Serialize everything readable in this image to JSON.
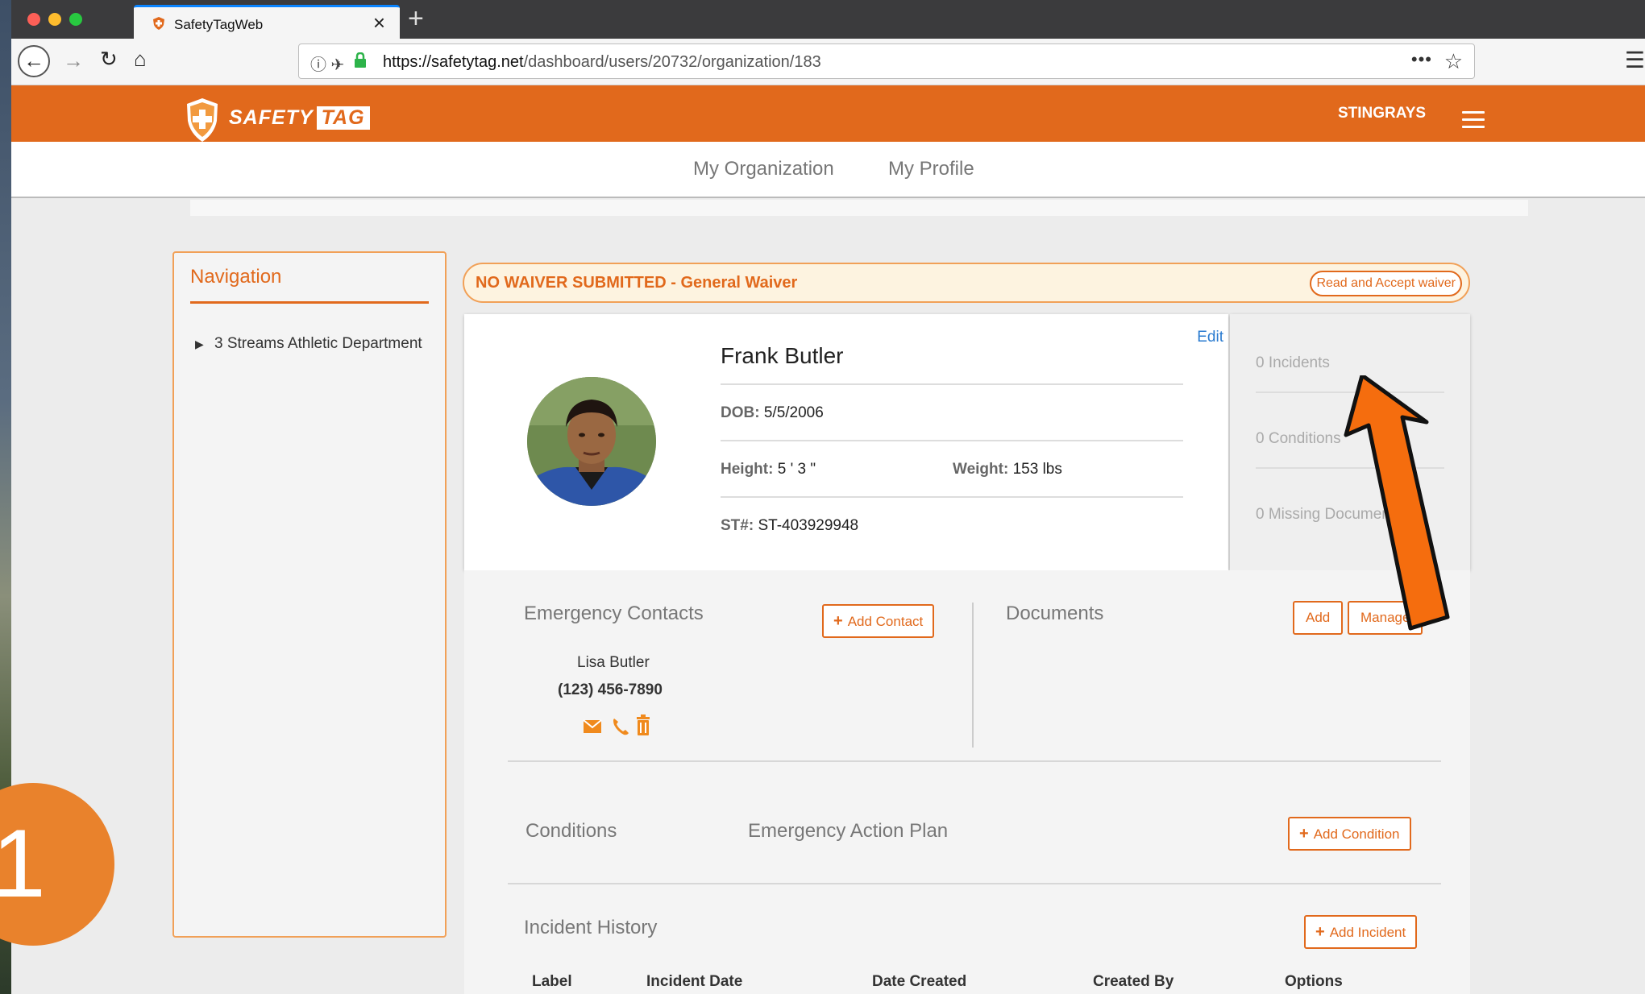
{
  "browser": {
    "tab_title": "SafetyTagWeb",
    "url_host": "https://safetytag.net",
    "url_path": "/dashboard/users/20732/organization/183"
  },
  "header": {
    "logo_text": "SAFETY",
    "logo_tag": "TAG",
    "org_name": "STINGRAYS",
    "brand_color": "#e1691c"
  },
  "subnav": {
    "my_organization": "My Organization",
    "my_profile": "My Profile"
  },
  "navigation": {
    "title": "Navigation",
    "items": [
      {
        "label": "3 Streams Athletic Department"
      }
    ]
  },
  "waiver": {
    "status": "NO WAIVER SUBMITTED - General Waiver",
    "button": "Read and Accept waiver"
  },
  "profile": {
    "name": "Frank Butler",
    "edit": "Edit",
    "dob_label": "DOB:",
    "dob": "5/5/2006",
    "height_label": "Height:",
    "height": "5 ' 3 \"",
    "weight_label": "Weight:",
    "weight": "153 lbs",
    "st_label": "ST#:",
    "st_number": "ST-403929948"
  },
  "stats": {
    "incidents": "0 Incidents",
    "conditions": "0 Conditions",
    "missing_documents": "0 Missing Documents"
  },
  "emergency_contacts": {
    "title": "Emergency Contacts",
    "add_button": "Add Contact",
    "contact_name": "Lisa Butler",
    "contact_phone": "(123) 456-7890"
  },
  "documents": {
    "title": "Documents",
    "add_button": "Add",
    "manage_button": "Manage"
  },
  "conditions": {
    "title": "Conditions",
    "eap_title": "Emergency Action Plan",
    "add_button": "Add Condition"
  },
  "incident_history": {
    "title": "Incident History",
    "add_button": "Add Incident",
    "columns": [
      "Label",
      "Incident Date",
      "Date Created",
      "Created By",
      "Options"
    ]
  },
  "overlay": {
    "step_number": "1"
  }
}
